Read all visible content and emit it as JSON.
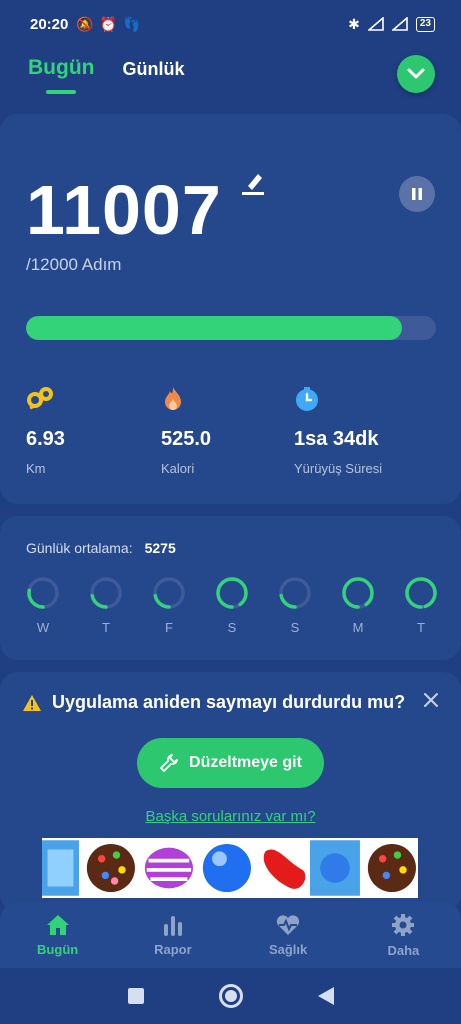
{
  "status_bar": {
    "time": "20:20",
    "battery": "23"
  },
  "header": {
    "tabs": [
      {
        "label": "Bugün",
        "active": true
      },
      {
        "label": "Günlük",
        "active": false
      }
    ]
  },
  "today": {
    "steps": "11007",
    "goal": "/12000 Adım",
    "progress_fraction": 0.917,
    "stats": [
      {
        "icon": "distance-icon",
        "value": "6.93",
        "label": "Km"
      },
      {
        "icon": "flame-icon",
        "value": "525.0",
        "label": "Kalori"
      },
      {
        "icon": "stopwatch-icon",
        "value": "1sa 34dk",
        "label": "Yürüyüş Süresi"
      }
    ]
  },
  "daily_average": {
    "label": "Günlük ortalama:",
    "value": "5275",
    "days": [
      {
        "label": "W",
        "fraction": 0.28
      },
      {
        "label": "T",
        "fraction": 0.22
      },
      {
        "label": "F",
        "fraction": 0.22
      },
      {
        "label": "S",
        "fraction": 0.9
      },
      {
        "label": "S",
        "fraction": 0.22
      },
      {
        "label": "M",
        "fraction": 0.9
      },
      {
        "label": "T",
        "fraction": 0.95
      }
    ]
  },
  "prompt": {
    "title": "Uygulama aniden saymayı durdurdu mu?",
    "fix_button": "Düzeltmeye git",
    "more_link": "Başka sorularınız var mı?"
  },
  "bottom_nav": [
    {
      "label": "Bugün",
      "icon": "home-icon",
      "active": true
    },
    {
      "label": "Rapor",
      "icon": "bar-chart-icon",
      "active": false
    },
    {
      "label": "Sağlık",
      "icon": "heart-pulse-icon",
      "active": false
    },
    {
      "label": "Daha",
      "icon": "gear-icon",
      "active": false
    }
  ],
  "colors": {
    "accent": "#33d37a",
    "background": "#1f3f82",
    "card": "#25488d"
  }
}
